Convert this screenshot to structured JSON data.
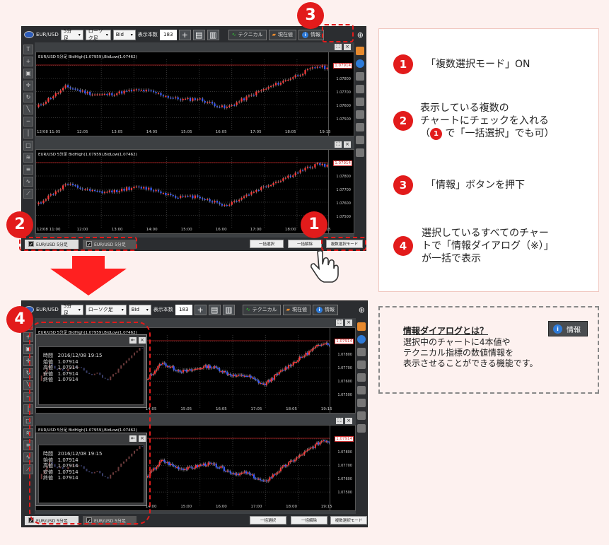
{
  "toolbar": {
    "pair": "EUR/USD",
    "period": "5分足",
    "chart_type": "ローソク足",
    "price": "Bid",
    "count_label": "表示本数",
    "count": "183",
    "plus": "+",
    "technical": "テクニカル",
    "current": "現在値",
    "info": "情報"
  },
  "charts": [
    {
      "title": "EUR/USD 5分足  BidHigh(1.07959),BidLow(1.07462)",
      "price_tag": "1.07914",
      "y_ticks": [
        "1.07800",
        "1.07700",
        "1.07600",
        "1.07500"
      ],
      "x_ticks": [
        "12/08  11:05",
        "12:05",
        "13:05",
        "14:05",
        "15:05",
        "16:05",
        "17:05",
        "18:05",
        "19:15"
      ]
    },
    {
      "title": "EUR/USD 5分足  BidHigh(1.07959),BidLow(1.07462)",
      "price_tag": "1.07914",
      "y_ticks": [
        "1.07800",
        "1.07700",
        "1.07600",
        "1.07500"
      ],
      "x_ticks": [
        "12/08  11:00",
        "12:00",
        "13:00",
        "14:00",
        "15:00",
        "16:00",
        "17:00",
        "18:00",
        "19:15"
      ]
    }
  ],
  "charts_after": [
    {
      "title": "EUR/USD 5分足  BidHigh(1.07959),BidLow(1.07462)",
      "price_tag": "1.07914",
      "y_ticks": [
        "1.07800",
        "1.07700",
        "1.07600",
        "1.07500"
      ],
      "x_ticks": [
        "14:05",
        "15:05",
        "16:05",
        "17:05",
        "18:05",
        "19:15"
      ]
    },
    {
      "title": "EUR/USD 5分足  BidHigh(1.07959),BidLow(1.07462)",
      "price_tag": "1.07914",
      "y_ticks": [
        "1.07800",
        "1.07700",
        "1.07600",
        "1.07500"
      ],
      "x_ticks": [
        "14:00",
        "15:00",
        "16:00",
        "17:00",
        "18:00",
        "19:15"
      ]
    }
  ],
  "bottom": {
    "tabs": [
      "EUR/USD 5分足",
      "EUR/USD 5分足"
    ],
    "select_all": "一括選択",
    "deselect_all": "一括解除",
    "multi_mode": "複数選択モード"
  },
  "info_dialog": {
    "rows": "時間   2016/12/08 19:15\n始値   1.07914\n高値   1.07914\n安値   1.07914\n終値   1.07914"
  },
  "steps": [
    {
      "num": "1",
      "text": "「複数選択モード」ON"
    },
    {
      "num": "2",
      "line1": "表示している複数の",
      "line2": "チャートにチェックを入れる",
      "pre": "（",
      "mini": "1",
      "post": " で「一括選択」でも可）"
    },
    {
      "num": "3",
      "text": "「情報」ボタンを押下"
    },
    {
      "num": "4",
      "text": "選択しているすべてのチャー\nトで「情報ダイアログ（※）」\nが一括で表示"
    }
  ],
  "badges": [
    "1",
    "2",
    "3",
    "4"
  ],
  "definition": {
    "title": "情報ダイアログとは？",
    "body": "選択中のチャートに4本値や\nテクニカル指標の数値情報を\n表示させることができる機能です。",
    "button": "情報"
  },
  "icons": [
    "arrow-down-icon",
    "hand-pointer-icon",
    "info-icon",
    "flag-icon"
  ]
}
